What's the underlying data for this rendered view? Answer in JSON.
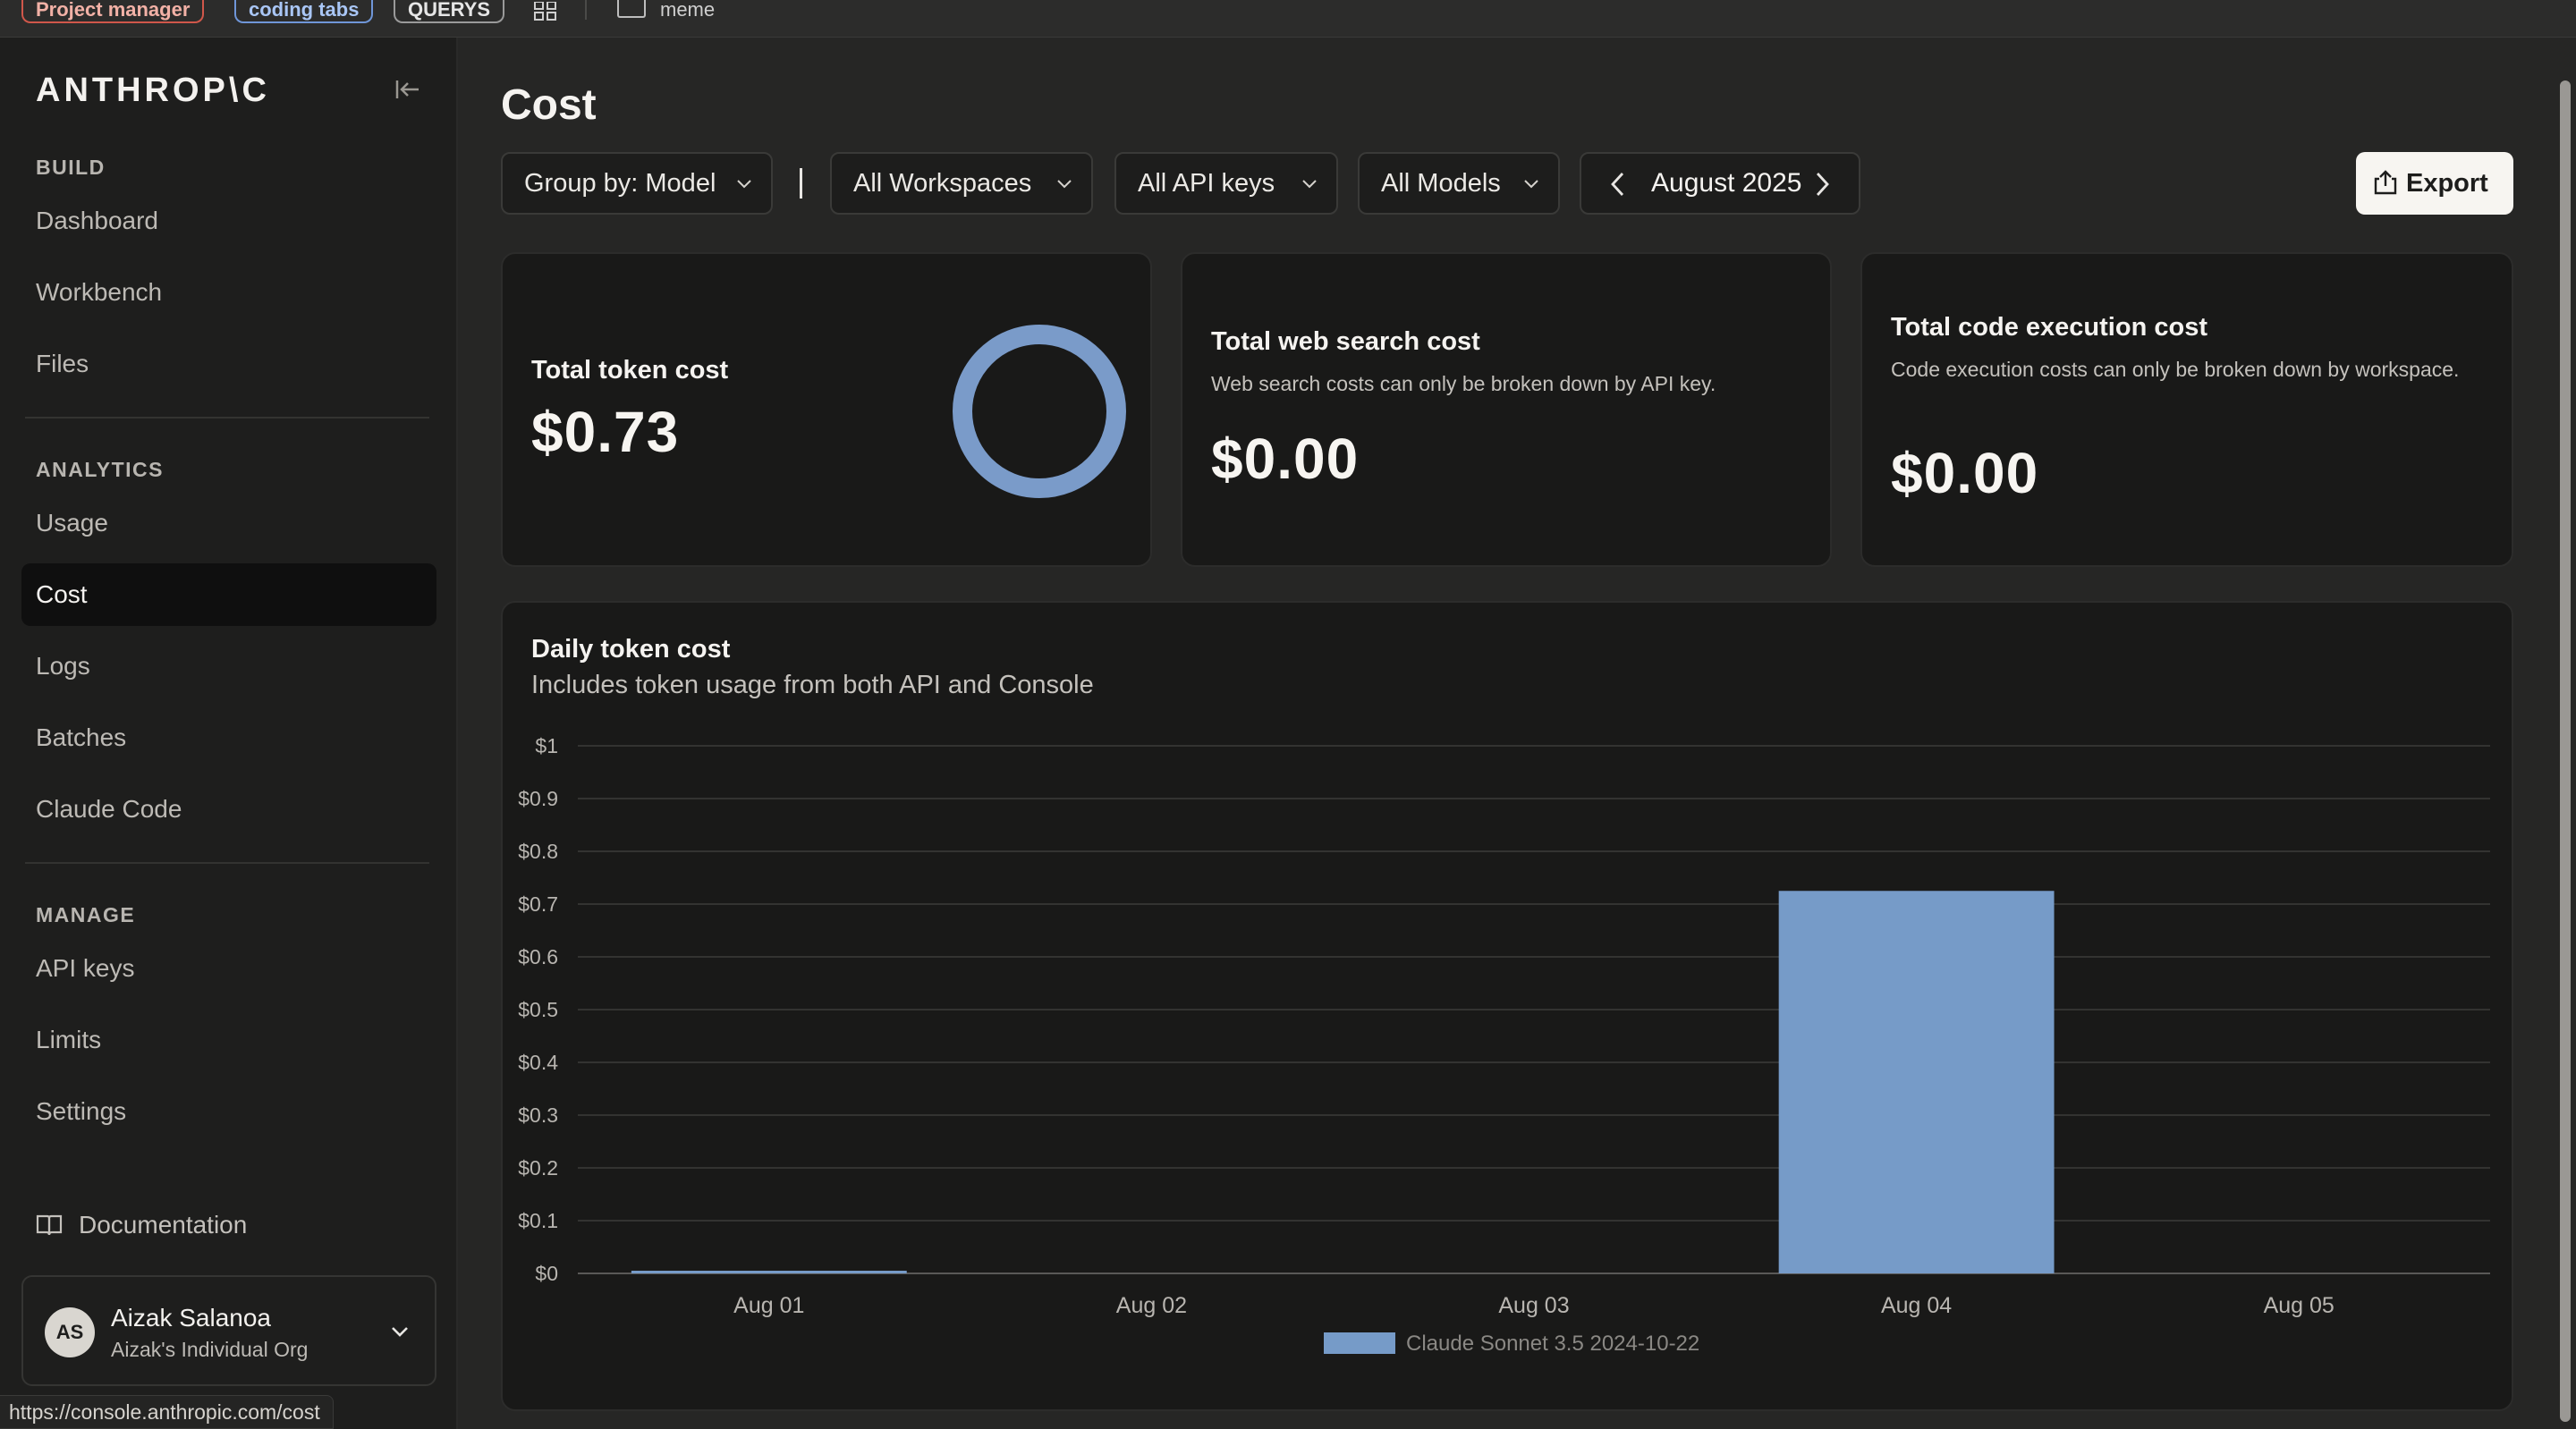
{
  "bookmarks": {
    "chips": [
      "Project manager",
      "coding tabs",
      "QUERYS"
    ],
    "folder_label": "meme"
  },
  "sidebar": {
    "logo": "ANTHROP\\C",
    "sections": {
      "build": "BUILD",
      "analytics": "ANALYTICS",
      "manage": "MANAGE"
    },
    "items": {
      "dashboard": "Dashboard",
      "workbench": "Workbench",
      "files": "Files",
      "usage": "Usage",
      "cost": "Cost",
      "logs": "Logs",
      "batches": "Batches",
      "claude_code": "Claude Code",
      "api_keys": "API keys",
      "limits": "Limits",
      "settings": "Settings"
    },
    "active_item": "Cost",
    "documentation": "Documentation",
    "user": {
      "initials": "AS",
      "name": "Aizak Salanoa",
      "org": "Aizak's Individual Org"
    }
  },
  "status_url": "https://console.anthropic.com/cost",
  "main": {
    "title": "Cost",
    "filters": {
      "group_by": "Group by: Model",
      "workspaces": "All Workspaces",
      "api_keys": "All API keys",
      "models": "All Models"
    },
    "month": "August 2025",
    "export_label": "Export",
    "cards": {
      "token": {
        "title": "Total token cost",
        "value": "$0.73",
        "ring_color": "#7a9bc9"
      },
      "web_search": {
        "title": "Total web search cost",
        "desc": "Web search costs can only be broken down by API key.",
        "value": "$0.00"
      },
      "code_exec": {
        "title": "Total code execution cost",
        "desc": "Code execution costs can only be broken down by workspace.",
        "value": "$0.00"
      }
    },
    "chart_title": "Daily token cost",
    "chart_subtitle": "Includes token usage from both API and Console"
  },
  "chart_data": {
    "type": "bar",
    "title": "Daily token cost",
    "subtitle": "Includes token usage from both API and Console",
    "categories": [
      "Aug 01",
      "Aug 02",
      "Aug 03",
      "Aug 04",
      "Aug 05"
    ],
    "series": [
      {
        "name": "Claude Sonnet 3.5 2024-10-22",
        "values": [
          0.005,
          0,
          0,
          0.725,
          0
        ],
        "color": "#769bc8"
      }
    ],
    "yticks": [
      "$0",
      "$0.1",
      "$0.2",
      "$0.3",
      "$0.4",
      "$0.5",
      "$0.6",
      "$0.7",
      "$0.8",
      "$0.9",
      "$1"
    ],
    "ylim": [
      0,
      1
    ],
    "grid": true,
    "legend_position": "bottom"
  }
}
